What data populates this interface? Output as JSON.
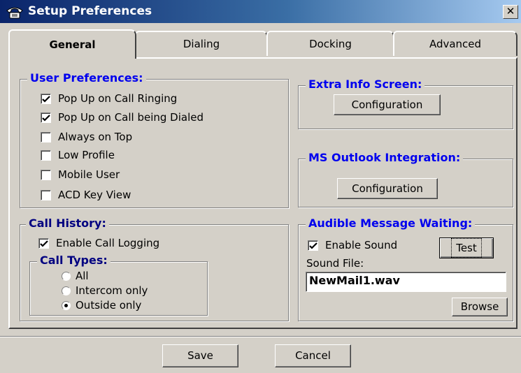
{
  "window": {
    "title": "Setup Preferences",
    "close_label": "✕"
  },
  "tabs": [
    {
      "label": "General",
      "active": true
    },
    {
      "label": "Dialing",
      "active": false
    },
    {
      "label": "Docking",
      "active": false
    },
    {
      "label": "Advanced",
      "active": false
    }
  ],
  "user_preferences": {
    "title": "User Preferences:",
    "options": [
      {
        "label": "Pop Up on Call Ringing",
        "checked": true
      },
      {
        "label": "Pop Up on Call being Dialed",
        "checked": true
      },
      {
        "label": "Always on Top",
        "checked": false
      },
      {
        "label": "Low Profile",
        "checked": false
      },
      {
        "label": "Mobile User",
        "checked": false
      },
      {
        "label": "ACD Key View",
        "checked": false
      }
    ]
  },
  "extra_info": {
    "title": "Extra Info Screen:",
    "button": "Configuration"
  },
  "outlook": {
    "title": "MS Outlook Integration:",
    "button": "Configuration"
  },
  "call_history": {
    "title": "Call History:",
    "enable_logging": {
      "label": "Enable Call Logging",
      "checked": true
    },
    "call_types": {
      "title": "Call Types:",
      "options": [
        {
          "label": "All",
          "selected": false
        },
        {
          "label": "Intercom only",
          "selected": false
        },
        {
          "label": "Outside only",
          "selected": true
        }
      ]
    }
  },
  "audible": {
    "title": "Audible Message Waiting:",
    "enable_sound": {
      "label": "Enable Sound",
      "checked": true
    },
    "test_button": "Test",
    "sound_file_label": "Sound File:",
    "sound_file_value": "NewMail1.wav",
    "browse_button": "Browse"
  },
  "footer": {
    "save": "Save",
    "cancel": "Cancel"
  }
}
